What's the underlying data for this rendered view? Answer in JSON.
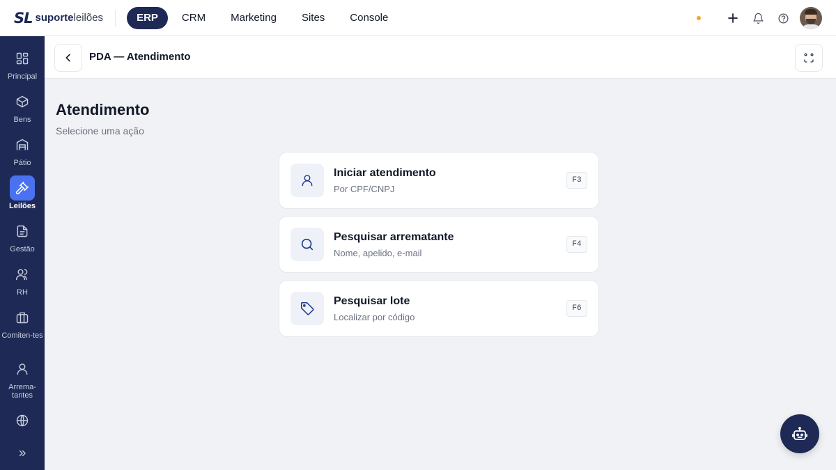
{
  "brand": {
    "mark": "SL",
    "name_bold": "suporte",
    "name_light": "leilões"
  },
  "topnav": {
    "tabs": [
      {
        "label": "ERP",
        "active": true
      },
      {
        "label": "CRM",
        "active": false
      },
      {
        "label": "Marketing",
        "active": false
      },
      {
        "label": "Sites",
        "active": false
      },
      {
        "label": "Console",
        "active": false
      }
    ],
    "icons": [
      "status-dot",
      "plus-icon",
      "bell-icon",
      "help-icon",
      "avatar"
    ],
    "status_color": "#f5a524"
  },
  "sidebar": {
    "items": [
      {
        "label": "Principal",
        "icon": "grid-icon",
        "active": false
      },
      {
        "label": "Bens",
        "icon": "box-icon",
        "active": false
      },
      {
        "label": "Pátio",
        "icon": "warehouse-icon",
        "active": false
      },
      {
        "label": "Leilões",
        "icon": "gavel-icon",
        "active": true
      },
      {
        "label": "Gestão",
        "icon": "document-icon",
        "active": false
      },
      {
        "label": "RH",
        "icon": "users-icon",
        "active": false
      },
      {
        "label": "Comiten-tes",
        "icon": "briefcase-icon",
        "active": false
      },
      {
        "label": "Arrema-tantes",
        "icon": "user-icon",
        "active": false
      },
      {
        "label": "",
        "icon": "globe-icon",
        "active": false
      }
    ],
    "expand_icon": "chevrons-right-icon"
  },
  "subheader": {
    "title": "PDA — Atendimento"
  },
  "main": {
    "title": "Atendimento",
    "subtitle": "Selecione uma ação",
    "actions": [
      {
        "title": "Iniciar atendimento",
        "description": "Por CPF/CNPJ",
        "shortcut": "F3",
        "icon": "user-icon"
      },
      {
        "title": "Pesquisar arrematante",
        "description": "Nome, apelido, e-mail",
        "shortcut": "F4",
        "icon": "search-icon"
      },
      {
        "title": "Pesquisar lote",
        "description": "Localizar por código",
        "shortcut": "F6",
        "icon": "tag-icon"
      }
    ]
  },
  "colors": {
    "brand_navy": "#1e2a55",
    "accent_blue": "#4a72f0",
    "background": "#f1f2f5"
  }
}
